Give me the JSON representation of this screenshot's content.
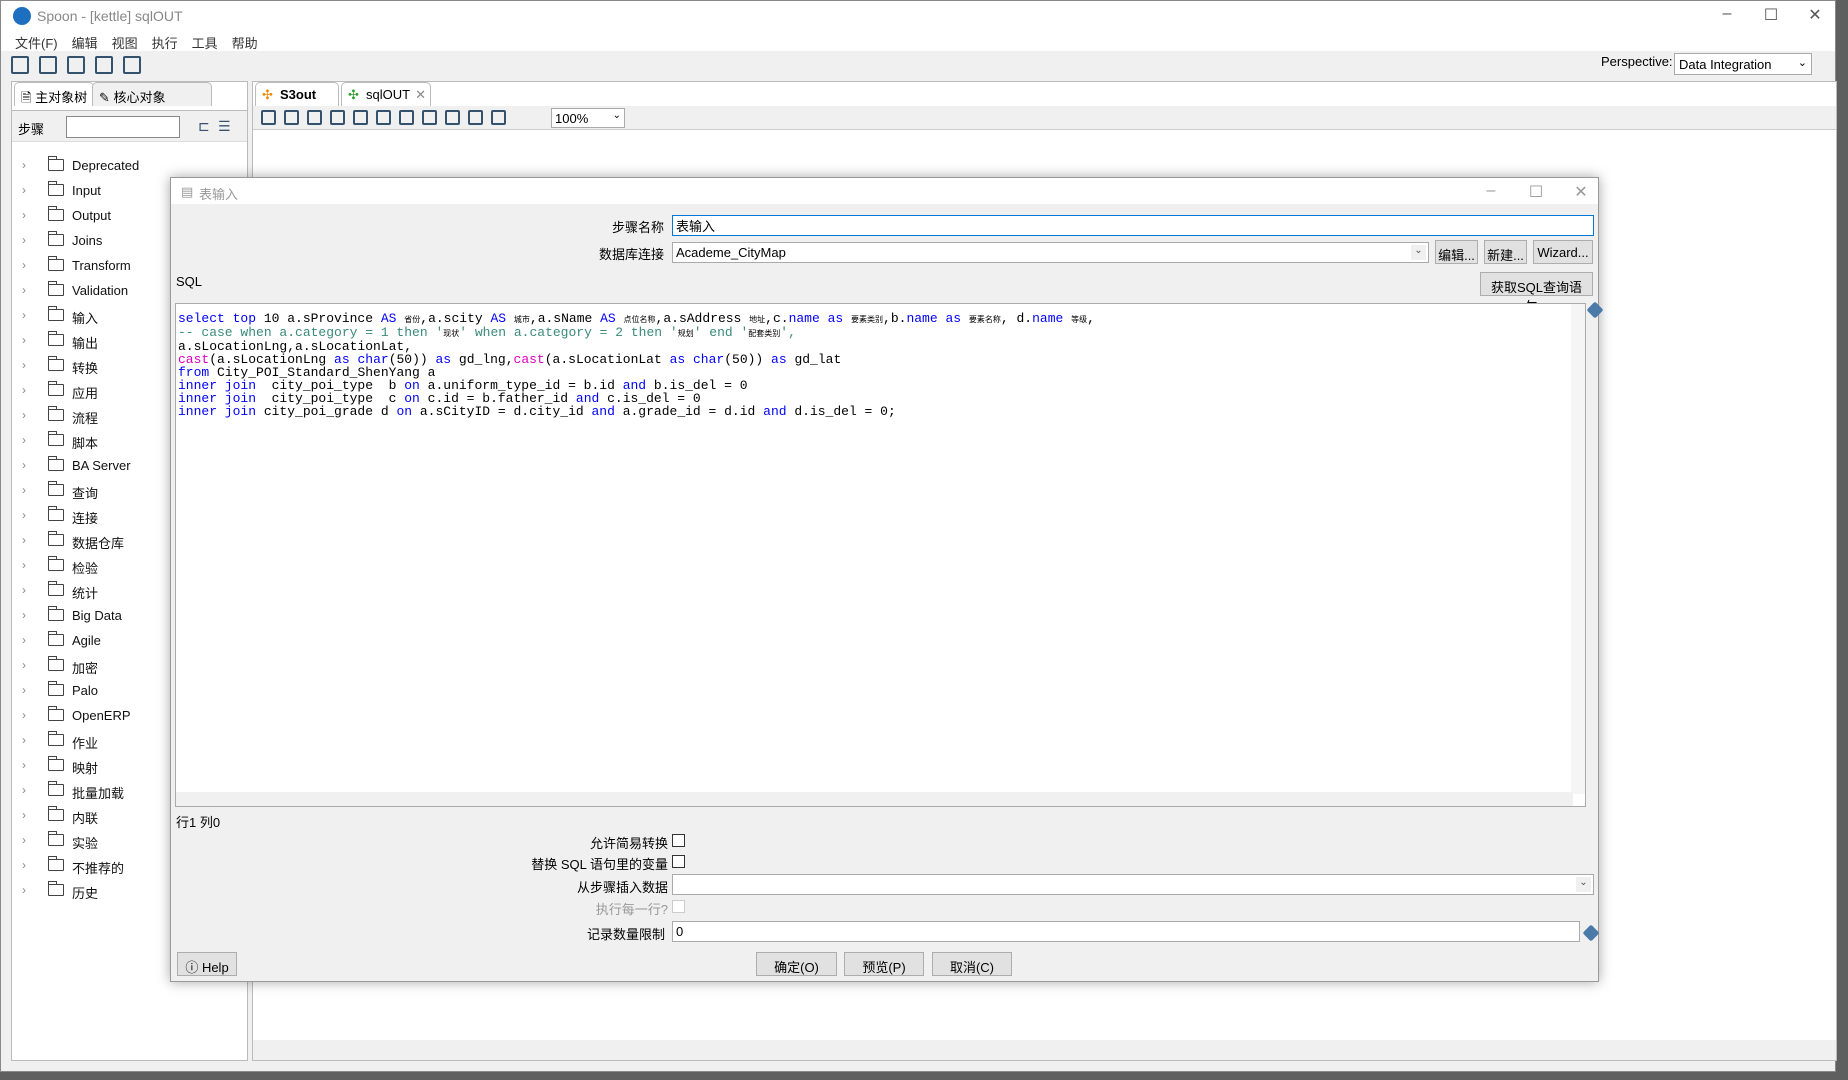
{
  "window": {
    "title": "Spoon - [kettle] sqlOUT"
  },
  "menu": [
    "文件(F)",
    "编辑",
    "视图",
    "执行",
    "工具",
    "帮助"
  ],
  "perspective": {
    "label": "Perspective:",
    "value": "Data Integration"
  },
  "left_panel": {
    "tabs": [
      "主对象树",
      "核心对象"
    ],
    "search_label": "步骤",
    "search_value": "",
    "tree": [
      "Deprecated",
      "Input",
      "Output",
      "Joins",
      "Transform",
      "Validation",
      "输入",
      "输出",
      "转换",
      "应用",
      "流程",
      "脚本",
      "BA Server",
      "查询",
      "连接",
      "数据仓库",
      "检验",
      "统计",
      "Big Data",
      "Agile",
      "加密",
      "Palo",
      "OpenERP",
      "作业",
      "映射",
      "批量加载",
      "内联",
      "实验",
      "不推荐的",
      "历史"
    ]
  },
  "editor_tabs": [
    {
      "label": "S3out",
      "active": false
    },
    {
      "label": "sqlOUT",
      "active": true
    }
  ],
  "zoom": "100%",
  "dialog": {
    "title": "表输入",
    "step_name_label": "步骤名称",
    "step_name": "表输入",
    "db_conn_label": "数据库连接",
    "db_conn": "Academe_CityMap",
    "edit_btn": "编辑...",
    "new_btn": "新建...",
    "wizard_btn": "Wizard...",
    "sql_label": "SQL",
    "get_sql_btn": "获取SQL查询语句...",
    "sql_lines": [
      [
        [
          "select top",
          "kw"
        ],
        [
          " 10 a.sProvince ",
          "tx"
        ],
        [
          "AS",
          "kw"
        ],
        [
          " ",
          "tx"
        ],
        [
          "省份",
          "cn"
        ],
        [
          ",a.scity ",
          "tx"
        ],
        [
          "AS",
          "kw"
        ],
        [
          " ",
          "tx"
        ],
        [
          "城市",
          "cn"
        ],
        [
          ",a.sName ",
          "tx"
        ],
        [
          "AS",
          "kw"
        ],
        [
          " ",
          "tx"
        ],
        [
          "点位名称",
          "cn"
        ],
        [
          ",a.sAddress ",
          "tx"
        ],
        [
          "地址",
          "cn"
        ],
        [
          ",c.",
          "tx"
        ],
        [
          "name",
          "kw"
        ],
        [
          " ",
          "tx"
        ],
        [
          "as",
          "kw"
        ],
        [
          " ",
          "tx"
        ],
        [
          "要素类别",
          "cn"
        ],
        [
          ",b.",
          "tx"
        ],
        [
          "name",
          "kw"
        ],
        [
          " ",
          "tx"
        ],
        [
          "as",
          "kw"
        ],
        [
          " ",
          "tx"
        ],
        [
          "要素名称",
          "cn"
        ],
        [
          ", d.",
          "tx"
        ],
        [
          "name",
          "kw"
        ],
        [
          " ",
          "tx"
        ],
        [
          "等级",
          "cn"
        ],
        [
          ",",
          "tx"
        ]
      ],
      [
        [
          "-- case when a.category = 1 then '",
          "cm"
        ],
        [
          "现状",
          "cn"
        ],
        [
          "' when a.category = 2 then '",
          "cm"
        ],
        [
          "规划",
          "cn"
        ],
        [
          "' end '",
          "cm"
        ],
        [
          "配套类别",
          "cn"
        ],
        [
          "',",
          "cm"
        ]
      ],
      [
        [
          "a.sLocationLng,a.sLocationLat,",
          "tx"
        ]
      ],
      [
        [
          "cast",
          "fn"
        ],
        [
          "(a.sLocationLng ",
          "tx"
        ],
        [
          "as",
          "kw"
        ],
        [
          " ",
          "tx"
        ],
        [
          "char",
          "kw"
        ],
        [
          "(50)) ",
          "tx"
        ],
        [
          "as",
          "kw"
        ],
        [
          " gd_lng,",
          "tx"
        ],
        [
          "cast",
          "fn"
        ],
        [
          "(a.sLocationLat ",
          "tx"
        ],
        [
          "as",
          "kw"
        ],
        [
          " ",
          "tx"
        ],
        [
          "char",
          "kw"
        ],
        [
          "(50)) ",
          "tx"
        ],
        [
          "as",
          "kw"
        ],
        [
          " gd_lat",
          "tx"
        ]
      ],
      [
        [
          "from",
          "kw"
        ],
        [
          " City_POI_Standard_ShenYang a",
          "tx"
        ]
      ],
      [
        [
          "inner join",
          "kw"
        ],
        [
          "  city_poi_type  b ",
          "tx"
        ],
        [
          "on",
          "kw"
        ],
        [
          " a.uniform_type_id = b.id ",
          "tx"
        ],
        [
          "and",
          "kw"
        ],
        [
          " b.is_del = 0",
          "tx"
        ]
      ],
      [
        [
          "inner join",
          "kw"
        ],
        [
          "  city_poi_type  c ",
          "tx"
        ],
        [
          "on",
          "kw"
        ],
        [
          " c.id = b.father_id ",
          "tx"
        ],
        [
          "and",
          "kw"
        ],
        [
          " c.is_del = 0",
          "tx"
        ]
      ],
      [
        [
          "inner join",
          "kw"
        ],
        [
          " city_poi_grade d ",
          "tx"
        ],
        [
          "on",
          "kw"
        ],
        [
          " a.sCityID = d.city_id ",
          "tx"
        ],
        [
          "and",
          "kw"
        ],
        [
          " a.grade_id = d.id ",
          "tx"
        ],
        [
          "and",
          "kw"
        ],
        [
          " d.is_del = 0;",
          "tx"
        ]
      ]
    ],
    "cursor_pos": "行1 列0",
    "lazy_conv_label": "允许简易转换",
    "lazy_conv": false,
    "replace_vars_label": "替换 SQL 语句里的变量",
    "replace_vars": false,
    "insert_from_label": "从步骤插入数据",
    "insert_from": "",
    "exec_each_label": "执行每一行?",
    "exec_each": false,
    "limit_label": "记录数量限制",
    "limit": "0",
    "ok_btn": "确定(O)",
    "preview_btn": "预览(P)",
    "cancel_btn": "取消(C)",
    "help_btn": "Help"
  },
  "colors": {
    "keyword": "#0000ff",
    "function": "#e000c0",
    "comment": "#3a8a7a",
    "focus": "#0078d7"
  }
}
